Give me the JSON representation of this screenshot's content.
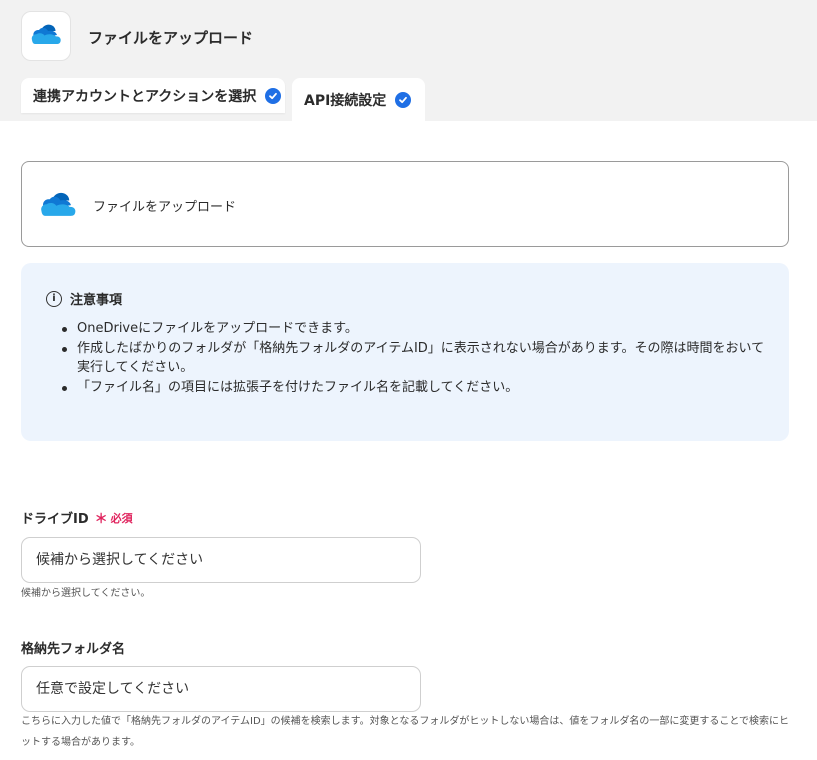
{
  "header": {
    "app_title": "ファイルをアップロード",
    "app_icon": "onedrive-cloud-icon"
  },
  "tabs": [
    {
      "label": "連携アカウントとアクションを選択",
      "completed": true
    },
    {
      "label": "API接続設定",
      "completed": true
    }
  ],
  "action": {
    "label": "ファイルをアップロード",
    "icon": "onedrive-cloud-icon"
  },
  "notice": {
    "title": "注意事項",
    "icon": "info-icon",
    "items": [
      "OneDriveにファイルをアップロードできます。",
      "作成したばかりのフォルダが「格納先フォルダのアイテムID」に表示されない場合があります。その際は時間をおいて実行してください。",
      "「ファイル名」の項目には拡張子を付けたファイル名を記載してください。"
    ]
  },
  "fields": {
    "drive_id": {
      "label": "ドライブID",
      "required_mark": "＊",
      "required_text": "必須",
      "placeholder": "候補から選択してください",
      "help": "候補から選択してください。"
    },
    "folder_name": {
      "label": "格納先フォルダ名",
      "placeholder": "任意で設定してください",
      "help": "こちらに入力した値で「格納先フォルダのアイテムID」の候補を検索します。対象となるフォルダがヒットしない場合は、値をフォルダ名の一部に変更することで検索にヒットする場合があります。"
    }
  },
  "colors": {
    "accent": "#1f6fe5",
    "required": "#e0245e",
    "notice_bg": "#edf4fd",
    "header_bg": "#f2f2f2"
  }
}
